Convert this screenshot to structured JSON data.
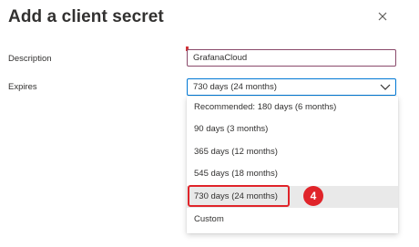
{
  "panel": {
    "title": "Add a client secret",
    "close_icon": "close-icon"
  },
  "form": {
    "description_label": "Description",
    "description_value": "GrafanaCloud",
    "expires_label": "Expires",
    "expires_selected": "730 days (24 months)"
  },
  "dropdown": {
    "options": [
      "Recommended: 180 days (6 months)",
      "90 days (3 months)",
      "365 days (12 months)",
      "545 days (18 months)",
      "730 days (24 months)",
      "Custom"
    ],
    "selected_index": 4
  },
  "annotation": {
    "step_number": "4",
    "color": "#e0242a"
  },
  "colors": {
    "focus_border": "#0078d4",
    "selected_option_bg": "#e9e9e9",
    "text": "#323130"
  }
}
